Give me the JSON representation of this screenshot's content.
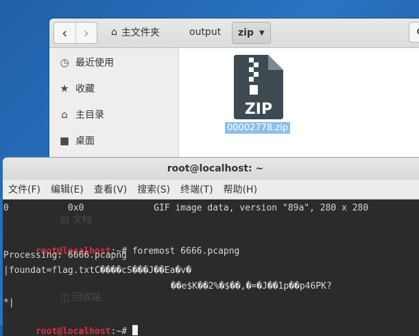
{
  "file_manager": {
    "nav": {
      "back_icon": "‹",
      "forward_icon": "›"
    },
    "breadcrumbs": [
      {
        "label": "主文件夹",
        "icon": "home-icon"
      },
      {
        "label": "output"
      },
      {
        "label": "zip",
        "active": true
      }
    ],
    "sidebar": {
      "items": [
        {
          "label": "最近使用",
          "icon": "recent-icon"
        },
        {
          "label": "收藏",
          "icon": "star-icon"
        },
        {
          "label": "主目录",
          "icon": "home-icon"
        },
        {
          "label": "桌面",
          "icon": "desktop-icon"
        },
        {
          "label": "文档",
          "icon": "document-icon"
        },
        {
          "label": "回收站",
          "icon": "trash-icon"
        }
      ]
    },
    "files": [
      {
        "name": "00002778.zip",
        "icon_text": "ZIP",
        "selected": true
      }
    ]
  },
  "terminal": {
    "title": "root@localhost: ~",
    "menu": [
      "文件(F)",
      "编辑(E)",
      "查看(V)",
      "搜索(S)",
      "终端(T)",
      "帮助(H)"
    ],
    "lines": {
      "gif_line": "0           0x0             GIF image data, version \"89a\", 280 x 280",
      "prompt1_user": "root@localhost",
      "prompt1_rest": ":~# foremost 6666.pcapng",
      "processing": "Processing: 6666.pcapng",
      "foundat": "|foundat=flag.txtC����cS���J��Ea�v�",
      "garbage": "��e$K��2%�$��,�=�J��1p��p46PK?",
      "star_line": "*|",
      "prompt2_user": "root@localhost",
      "prompt2_rest": ":~# "
    }
  }
}
